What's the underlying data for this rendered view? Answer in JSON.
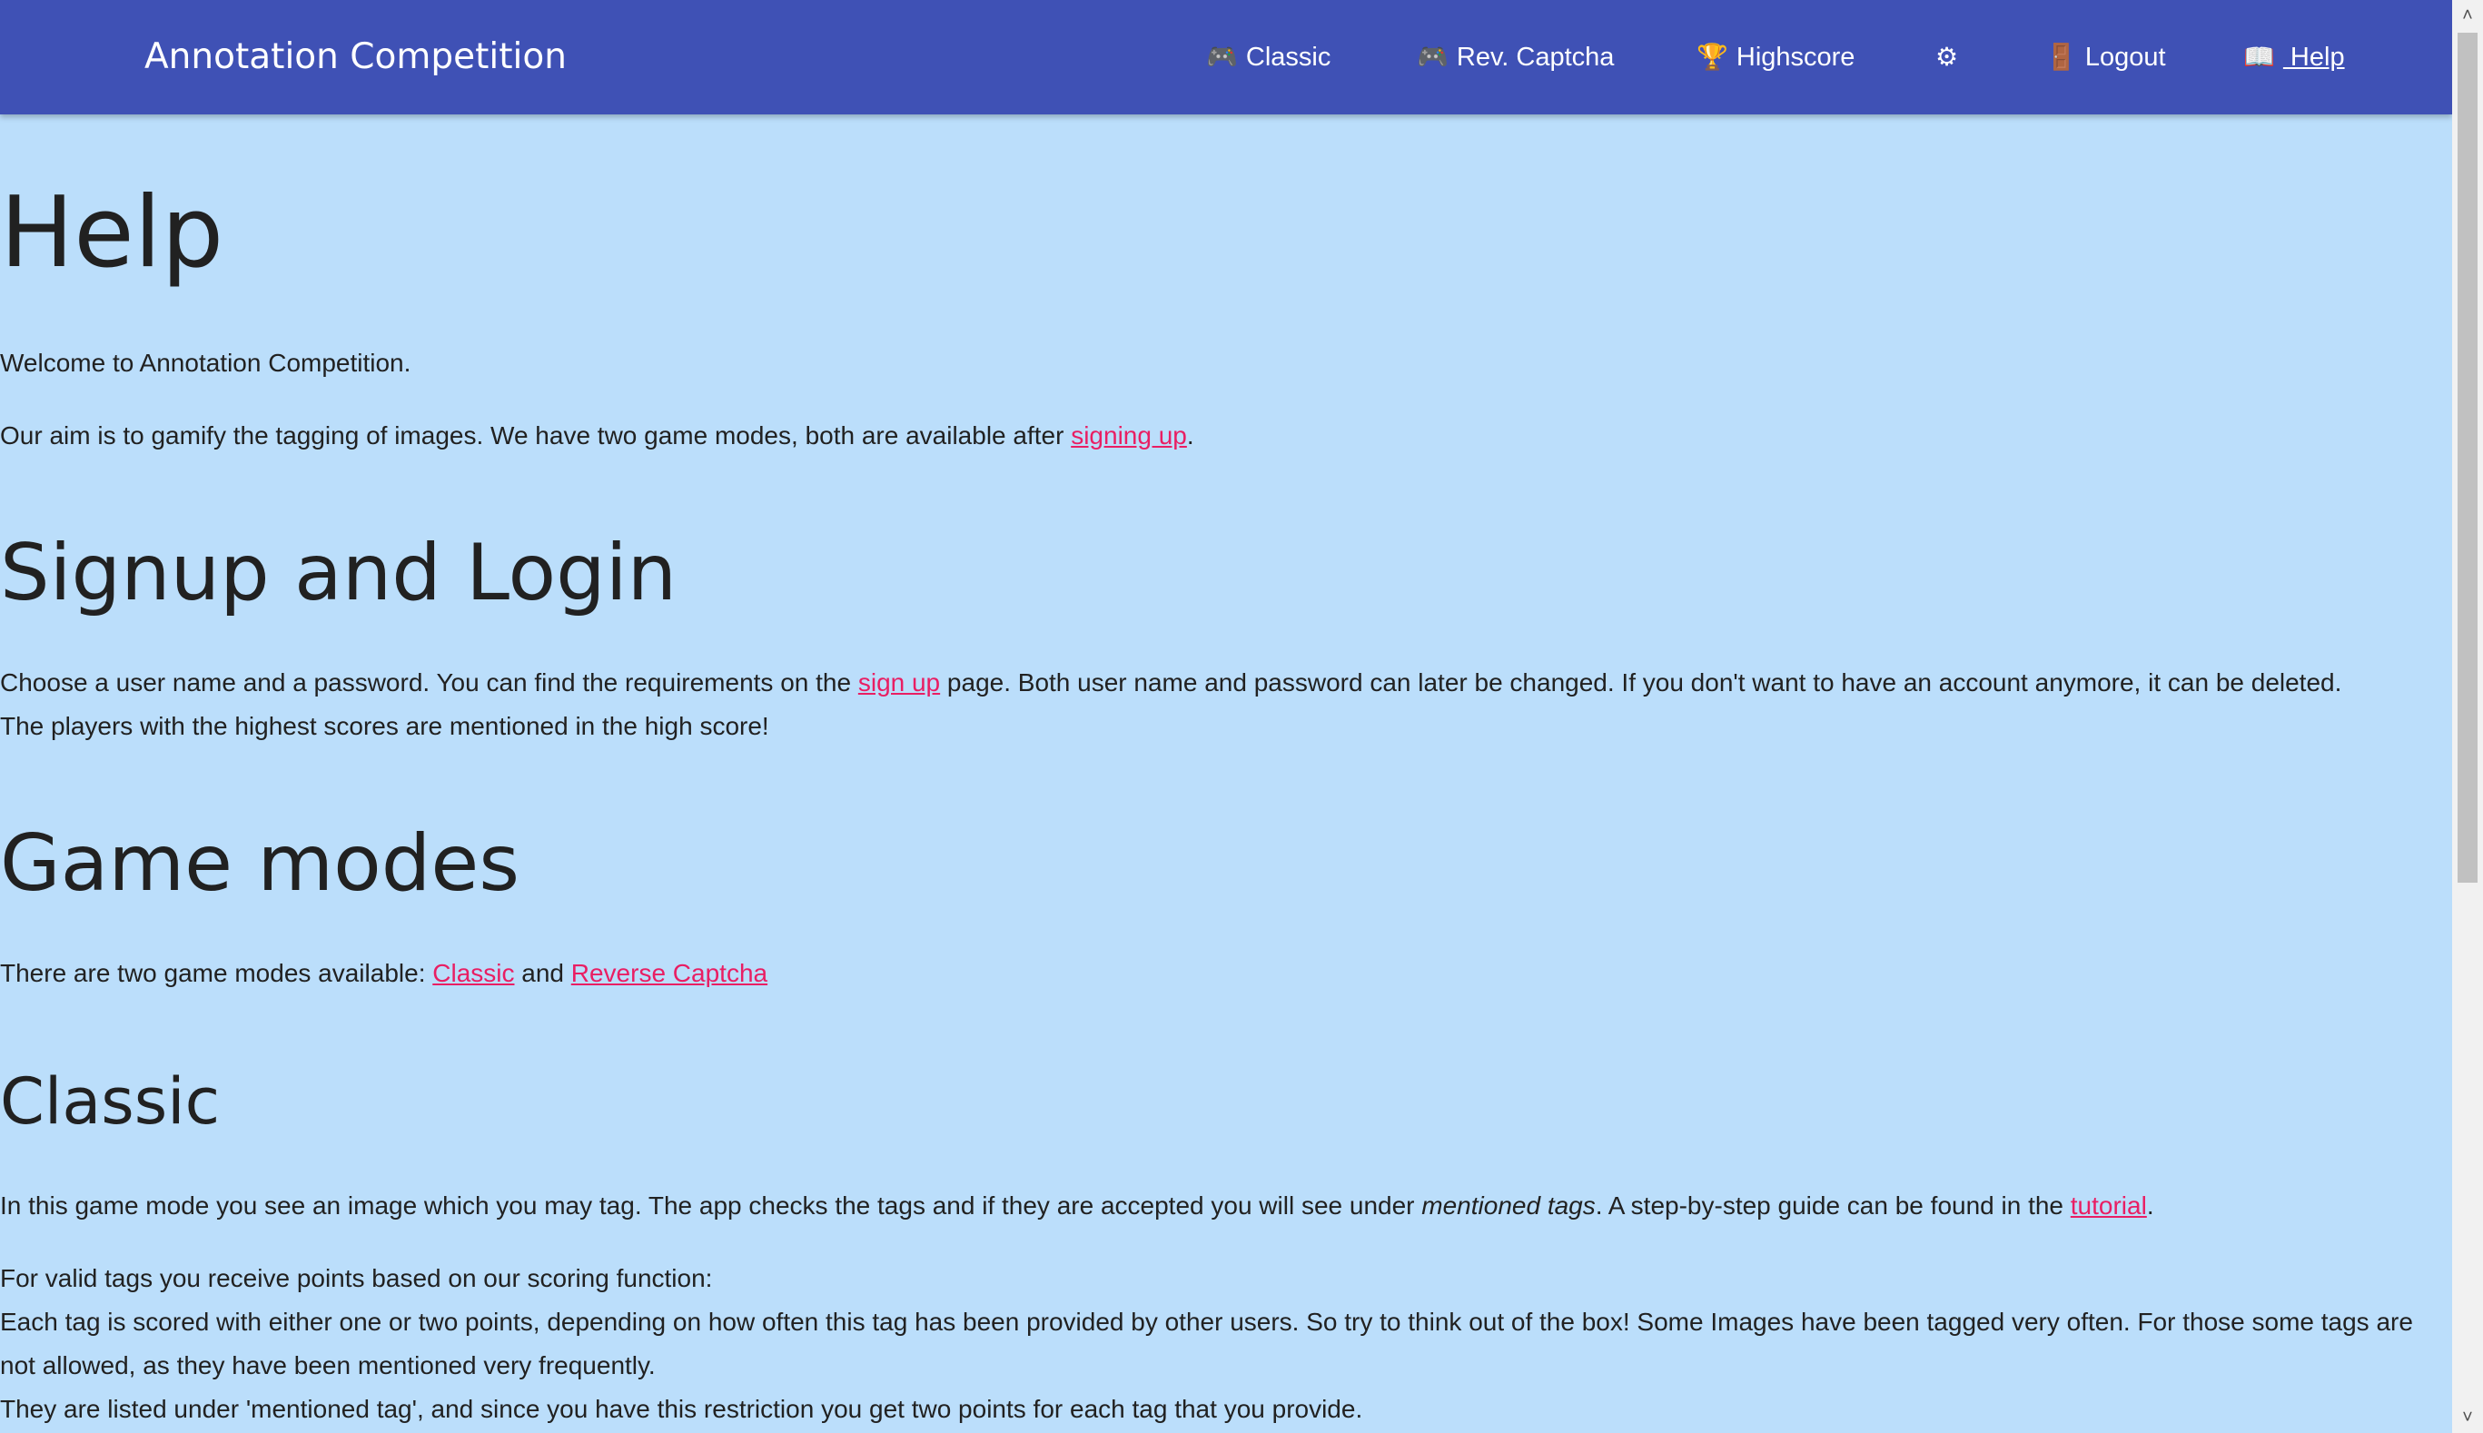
{
  "navbar": {
    "brand": "Annotation Competition",
    "items": [
      {
        "icon": "🎮",
        "icon_name": "gamepad-icon",
        "label": "Classic"
      },
      {
        "icon": "🎮",
        "icon_name": "gamepad-icon",
        "label": "Rev. Captcha"
      },
      {
        "icon": "🏆",
        "icon_name": "trophy-icon",
        "label": "Highscore"
      },
      {
        "icon": "⚙",
        "icon_name": "gear-icon",
        "label": ""
      },
      {
        "icon": "🚪",
        "icon_name": "door-icon",
        "label": "Logout"
      },
      {
        "icon": "📖",
        "icon_name": "book-icon",
        "label": " Help"
      }
    ]
  },
  "content": {
    "title": "Help",
    "welcome": "Welcome to Annotation Competition.",
    "aim": {
      "before": "Our aim is to gamify the tagging of images. We have two game modes, both are available after ",
      "link": "signing up",
      "after": "."
    },
    "signup_section": {
      "heading": "Signup and Login",
      "before": "Choose a user name and a password. You can find the requirements on the ",
      "link": "sign up",
      "after": " page. Both user name and password can later be changed. If you don't want to have an account anymore, it can be deleted.",
      "line2": "The players with the highest scores are mentioned in the high score!"
    },
    "gamemodes_section": {
      "heading": "Game modes",
      "before": "There are two game modes available: ",
      "link1": "Classic",
      "middle": " and ",
      "link2": "Reverse Captcha"
    },
    "classic_section": {
      "heading": "Classic",
      "intro_before": "In this game mode you see an image which you may tag. The app checks the tags and if they are accepted you will see under ",
      "intro_em": "mentioned tags",
      "intro_middle": ". A step-by-step guide can be found in the ",
      "intro_link": "tutorial",
      "intro_after": ".",
      "scoring_line1": "For valid tags you receive points based on our scoring function:",
      "scoring_line2": "Each tag is scored with either one or two points, depending on how often this tag has been provided by other users. So try to think out of the box! Some Images have been tagged very often. For those some tags are not allowed, as they have been mentioned very frequently.",
      "scoring_line3": "They are listed under 'mentioned tag', and since you have this restriction you get two points for each tag that you provide."
    }
  },
  "scrollbar": {
    "up_icon": "˄",
    "down_icon": "˅"
  }
}
